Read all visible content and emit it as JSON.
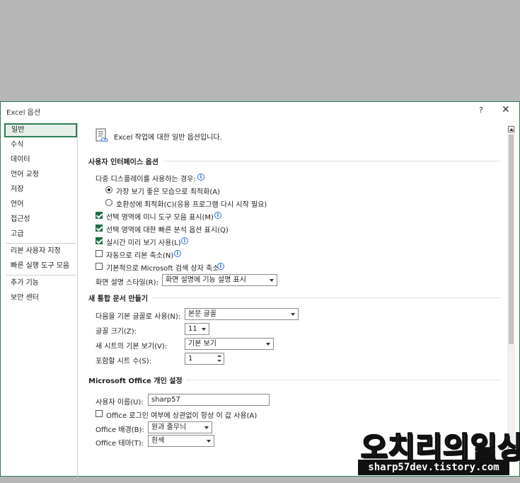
{
  "window": {
    "title": "Excel 옵션",
    "help_label": "?",
    "close_label": "✕"
  },
  "nav": {
    "items": [
      {
        "label": "일반",
        "active": true
      },
      {
        "label": "수식"
      },
      {
        "label": "데이터"
      },
      {
        "label": "언어 교정"
      },
      {
        "label": "저장"
      },
      {
        "label": "언어"
      },
      {
        "label": "접근성"
      },
      {
        "label": "고급"
      },
      {
        "label": "리본 사용자 지정"
      },
      {
        "label": "빠른 실행 도구 모음"
      },
      {
        "label": "추가 기능"
      },
      {
        "label": "보안 센터"
      }
    ]
  },
  "main": {
    "intro": "Excel 작업에 대한 일반 옵션입니다.",
    "ui_section": {
      "title": "사용자 인터페이스 옵션",
      "multi_display_label": "다중 디스플레이를 사용하는 경우:",
      "radio_best_look": "가장 보기 좋은 모습으로 최적화(A)",
      "radio_compat": "호환성에 최적화(C)(응용 프로그램 다시 시작 필요)",
      "cb_mini_toolbar": "선택 영역에 미니 도구 모음 표시(M)",
      "cb_quick_analysis": "선택 영역에 대한 빠른 분석 옵션 표시(Q)",
      "cb_live_preview": "실시간 미리 보기 사용(L)",
      "cb_collapse_ribbon": "자동으로 리본 축소(N)",
      "cb_collapse_search": "기본적으로 Microsoft 검색 상자 축소",
      "screentip_label": "화면 설명 스타일(R):",
      "screentip_value": "화면 설명에 기능 설명 표시"
    },
    "new_wb_section": {
      "title": "새 통합 문서 만들기",
      "font_label": "다음을 기본 글꼴로 사용(N):",
      "font_value": "본문 글꼴",
      "size_label": "글꼴 크기(Z):",
      "size_value": "11",
      "view_label": "새 시트의 기본 보기(V):",
      "view_value": "기본 보기",
      "sheets_label": "포함할 시트 수(S):",
      "sheets_value": "1"
    },
    "office_section": {
      "title": "Microsoft Office 개인 설정",
      "username_label": "사용자 이름(U):",
      "username_value": "sharp57",
      "cb_always_use": "Office 로그인 여부에 상관없이 항상 이 값 사용(A)",
      "background_label": "Office 배경(B):",
      "background_value": "원과 줄무늬",
      "theme_label": "Office 테마(T):",
      "theme_value": "흰색"
    }
  },
  "watermark": {
    "title": "오치리의일상",
    "subtitle": "sharp57dev.tistory.com"
  },
  "colors": {
    "accent": "#2d7d56",
    "check": "#1f6e46",
    "info": "#2b6ed8"
  }
}
